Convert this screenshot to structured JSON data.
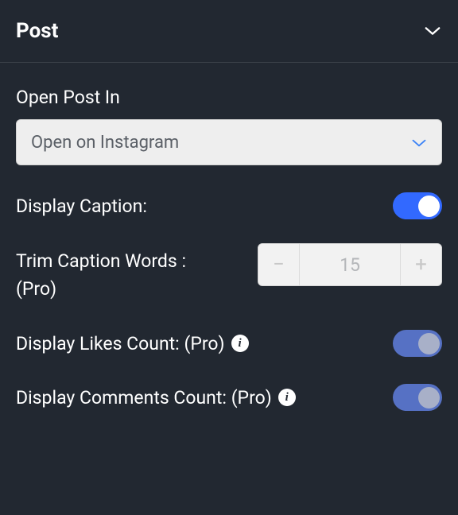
{
  "header": {
    "title": "Post"
  },
  "openPostIn": {
    "label": "Open Post In",
    "selected": "Open on Instagram"
  },
  "displayCaption": {
    "label": "Display Caption:",
    "value": true
  },
  "trimCaption": {
    "label_line1": "Trim Caption Words :",
    "label_line2": "(Pro)",
    "value": "15"
  },
  "displayLikes": {
    "label": "Display Likes Count: (Pro)",
    "value": true,
    "disabled": true
  },
  "displayComments": {
    "label": "Display Comments Count: (Pro)",
    "value": true,
    "disabled": true
  }
}
